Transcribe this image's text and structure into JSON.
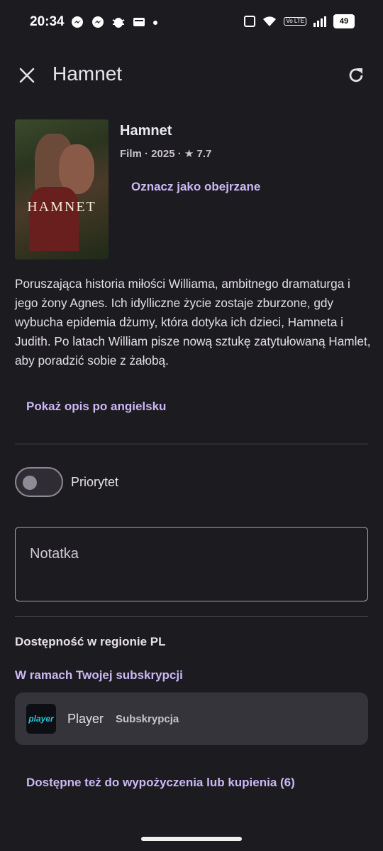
{
  "status_bar": {
    "time": "20:34",
    "battery": "49",
    "volte": "Vo LTE",
    "icons": [
      "messenger-icon",
      "messenger-icon",
      "bug-icon",
      "wallet-icon",
      "dot-icon",
      "nfc-icon",
      "wifi-icon",
      "volte-icon",
      "signal-icon",
      "battery-icon"
    ]
  },
  "app_bar": {
    "title": "Hamnet",
    "close_icon": "close-icon",
    "refresh_icon": "refresh-icon"
  },
  "movie": {
    "poster_text": "HAMNET",
    "title": "Hamnet",
    "meta": "Film · 2025 · ★ 7.7",
    "mark_watched": "Oznacz jako obejrzane",
    "description": "Poruszająca historia miłości Williama, ambitnego dramaturga i jego żony Agnes. Ich idylliczne życie zostaje zburzone, gdy wybucha epidemia dżumy, która dotyka ich dzieci, Hamneta i Judith. Po latach William pisze nową sztukę zatytułowaną Hamlet, aby poradzić sobie z żałobą.",
    "show_english": "Pokaż opis po angielsku"
  },
  "priority": {
    "label": "Priorytet",
    "enabled": false
  },
  "note": {
    "placeholder": "Notatka"
  },
  "availability": {
    "heading": "Dostępność w regionie PL",
    "subscription_link": "W ramach Twojej subskrypcji",
    "provider": {
      "logo_text": "player",
      "name": "Player",
      "type": "Subskrypcja"
    },
    "rent_buy_link": "Dostępne też do wypożyczenia lub kupienia (6)"
  },
  "colors": {
    "background": "#1c1b20",
    "accent": "#cbb8f4",
    "card": "#36343b"
  }
}
